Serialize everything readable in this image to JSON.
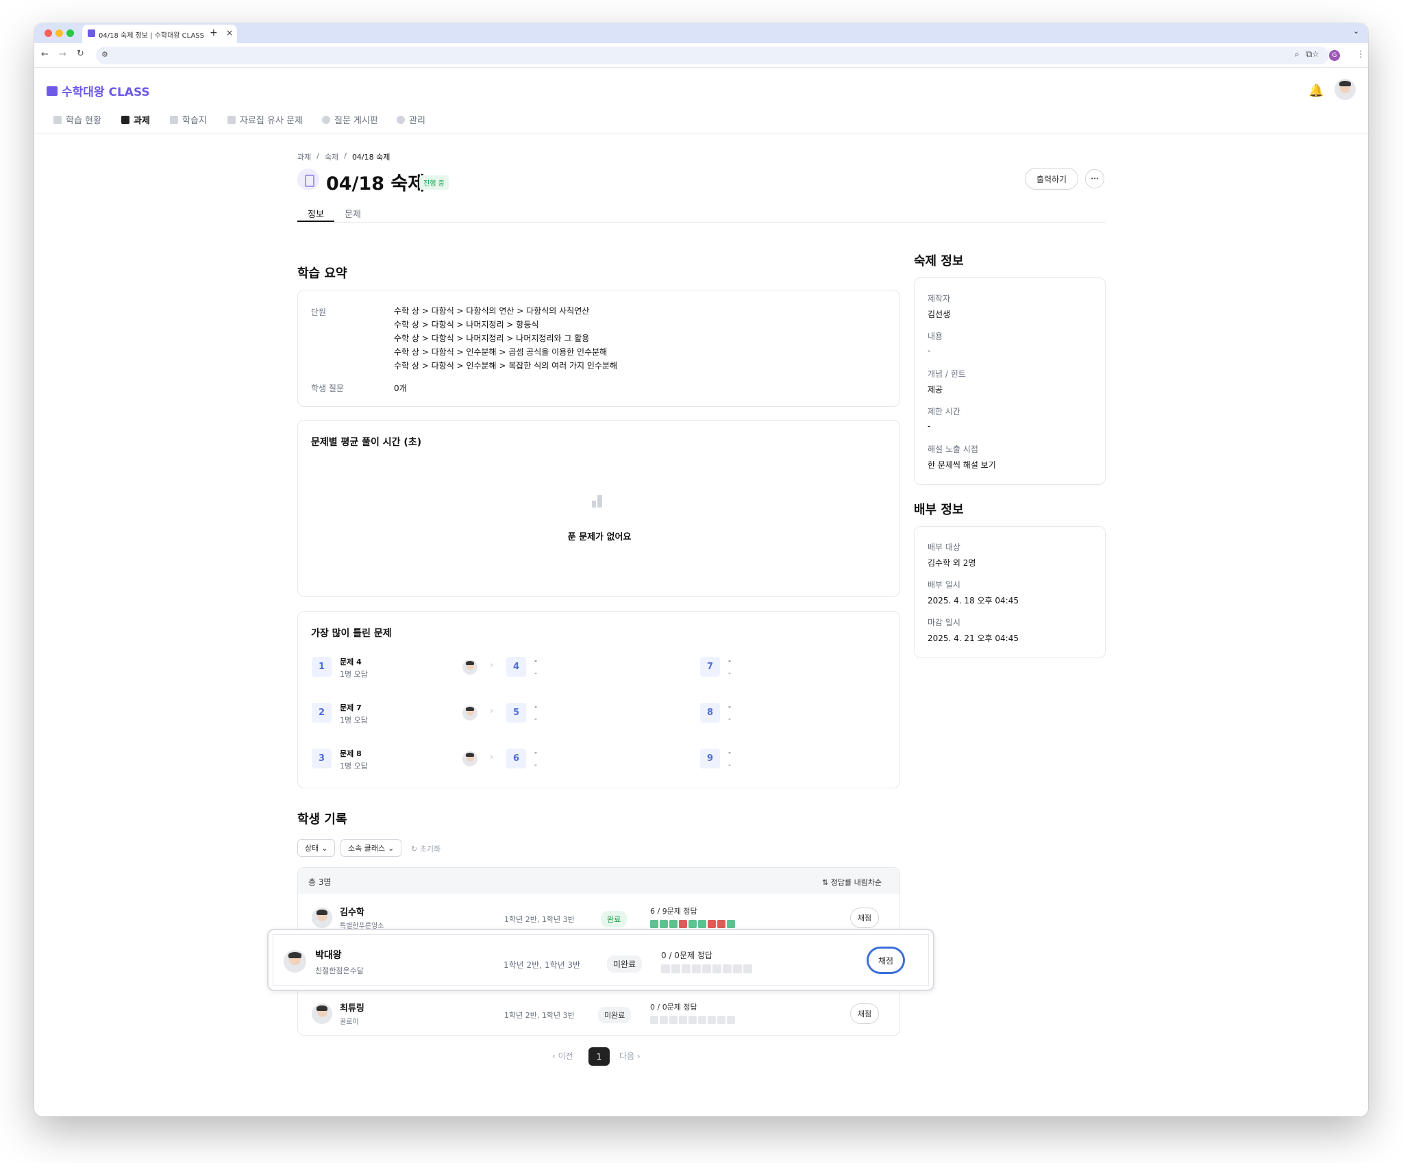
{
  "browser": {
    "tab_title": "04/18 숙제 정보 | 수학대왕 CLASS",
    "tab_close": "×",
    "new_tab": "+",
    "profile_letter": "G"
  },
  "app": {
    "brand": "수학대왕 CLASS",
    "nav": [
      {
        "label": "학습 현황"
      },
      {
        "label": "과제"
      },
      {
        "label": "학습지"
      },
      {
        "label": "자료집 유사 문제"
      },
      {
        "label": "질문 게시판"
      },
      {
        "label": "관리"
      }
    ]
  },
  "breadcrumb": [
    "과제",
    "숙제",
    "04/18 숙제"
  ],
  "breadcrumb_sep": "/",
  "page": {
    "title": "04/18 숙제",
    "status_badge": "진행 중",
    "print_button": "출력하기",
    "more_button": "···",
    "tabs": [
      "정보",
      "문제"
    ]
  },
  "summary": {
    "title": "학습 요약",
    "unit_label": "단원",
    "units": [
      "수학 상 > 다항식 > 다항식의 연산 > 다항식의 사칙연산",
      "수학 상 > 다항식 > 나머지정리 > 항등식",
      "수학 상 > 다항식 > 나머지정리 > 나머지정리와 그 활용",
      "수학 상 > 다항식 > 인수분해 > 곱셈 공식을 이용한 인수분해",
      "수학 상 > 다항식 > 인수분해 > 복잡한 식의 여러 가지 인수분해"
    ],
    "question_label": "학생 질문",
    "question_value": "0개"
  },
  "avg_time": {
    "title": "문제별 평균 풀이 시간 (초)",
    "empty": "푼 문제가 없어요"
  },
  "most_wrong": {
    "title": "가장 많이 틀린 문제",
    "col1": [
      {
        "num": "1",
        "name": "문제 4",
        "sub": "1명 오답"
      },
      {
        "num": "2",
        "name": "문제 7",
        "sub": "1명 오답"
      },
      {
        "num": "3",
        "name": "문제 8",
        "sub": "1명 오답"
      }
    ],
    "col2": [
      {
        "num": "4",
        "name": "-",
        "sub": "-"
      },
      {
        "num": "5",
        "name": "-",
        "sub": "-"
      },
      {
        "num": "6",
        "name": "-",
        "sub": "-"
      }
    ],
    "col3": [
      {
        "num": "7",
        "name": "-",
        "sub": "-"
      },
      {
        "num": "8",
        "name": "-",
        "sub": "-"
      },
      {
        "num": "9",
        "name": "-",
        "sub": "-"
      }
    ]
  },
  "records": {
    "title": "학생 기록",
    "filter_status": "상태",
    "filter_class": "소속 클래스",
    "reset": "초기화",
    "total": "총 3명",
    "sort": "정답률 내림차순",
    "students": [
      {
        "name": "김수학",
        "school": "특별한푸른엉소",
        "classes": "1학년 2반, 1학년 3반",
        "status": "완료",
        "score": "6 / 9문제 정답",
        "grade": "채점",
        "results": [
          "c",
          "c",
          "c",
          "w",
          "c",
          "c",
          "w",
          "w",
          "c"
        ]
      },
      {
        "name": "박대왕",
        "school": "친절한점은수달",
        "classes": "1학년 2반, 1학년 3반",
        "status": "미완료",
        "score": "0 / 0문제 정답",
        "grade": "채점",
        "results": [
          "n",
          "n",
          "n",
          "n",
          "n",
          "n",
          "n",
          "n",
          "n"
        ]
      },
      {
        "name": "최튜링",
        "school": "꿀로이",
        "classes": "1학년 2반, 1학년 3반",
        "status": "미완료",
        "score": "0 / 0문제 정답",
        "grade": "채점",
        "results": [
          "n",
          "n",
          "n",
          "n",
          "n",
          "n",
          "n",
          "n",
          "n"
        ]
      }
    ],
    "pager": {
      "prev": "이전",
      "page": "1",
      "next": "다음"
    }
  },
  "homework_info": {
    "title": "숙제 정보",
    "items": [
      {
        "label": "제작자",
        "value": "김선생"
      },
      {
        "label": "내용",
        "value": "-"
      },
      {
        "label": "개념 / 힌트",
        "value": "제공"
      },
      {
        "label": "제한 시간",
        "value": "-"
      },
      {
        "label": "해설 노출 시점",
        "value": "한 문제씩 해설 보기"
      }
    ]
  },
  "distribution_info": {
    "title": "배부 정보",
    "items": [
      {
        "label": "배부 대상",
        "value": "김수학 외 2명"
      },
      {
        "label": "배부 일시",
        "value": "2025. 4. 18 오후 04:45"
      },
      {
        "label": "마감 일시",
        "value": "2025. 4. 21 오후 04:45"
      }
    ]
  },
  "colors": {
    "brand": "#6d5ae6",
    "correct": "#5cc290",
    "wrong": "#e05a5a",
    "none": "#e5e7eb",
    "focus": "#3b6fd8"
  }
}
